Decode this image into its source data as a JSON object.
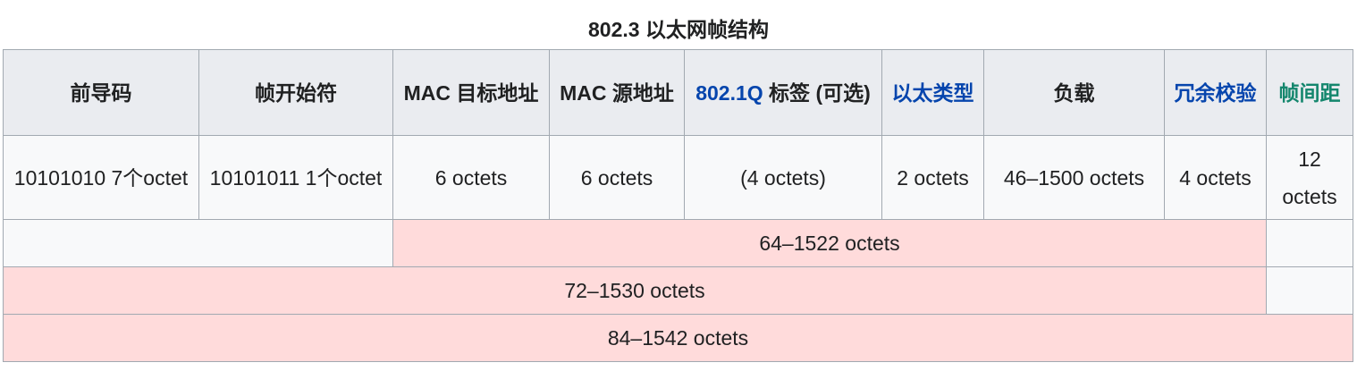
{
  "caption": "802.3 以太网帧结构",
  "headers": {
    "preamble": "前导码",
    "sfd": "帧开始符",
    "mac_dst": "MAC 目标地址",
    "mac_src": "MAC 源地址",
    "vlan_link": "802.1Q",
    "vlan_rest": " 标签 (可选)",
    "ethertype": "以太类型",
    "payload": "负载",
    "fcs": "冗余校验",
    "ifg": "帧间距"
  },
  "sizes": {
    "preamble": "10101010 7个octet",
    "sfd": "10101011 1个octet",
    "mac_dst": "6 octets",
    "mac_src": "6 octets",
    "vlan": "(4 octets)",
    "ethertype": "2 octets",
    "payload": "46–1500 octets",
    "fcs": "4 octets",
    "ifg": "12 octets"
  },
  "totals": {
    "frame": "64–1522 octets",
    "packet": "72–1530 octets",
    "with_gap": "84–1542 octets"
  },
  "colors": {
    "link": "#0645ad",
    "link_visited_green": "#14866d",
    "highlight": "#ffdbdb"
  }
}
